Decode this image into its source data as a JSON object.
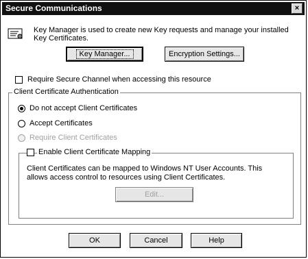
{
  "window": {
    "title": "Secure Communications",
    "close_glyph": "×"
  },
  "info": {
    "icon": "key-certificate-icon",
    "text_line1": "Key Manager is used to create new Key requests and manage your installed",
    "text_line2": "Key Certificates."
  },
  "buttons": {
    "key_manager": "Key Manager...",
    "encryption_settings": "Encryption Settings...",
    "edit": "Edit...",
    "ok": "OK",
    "cancel": "Cancel",
    "help": "Help"
  },
  "require_secure_channel": {
    "label": "Require Secure Channel when accessing this resource",
    "checked": false
  },
  "client_cert_auth": {
    "title": "Client Certificate Authentication",
    "options": [
      {
        "label": "Do not accept Client Certificates",
        "selected": true,
        "enabled": true
      },
      {
        "label": "Accept Certificates",
        "selected": false,
        "enabled": true
      },
      {
        "label": "Require Client Certificates",
        "selected": false,
        "enabled": false
      }
    ],
    "mapping": {
      "label": "Enable Client Certificate Mapping",
      "checked": false,
      "desc_line1": "Client Certificates can be mapped to Windows NT User Accounts.  This",
      "desc_line2": "allows access control to resources using Client Certificates."
    }
  }
}
